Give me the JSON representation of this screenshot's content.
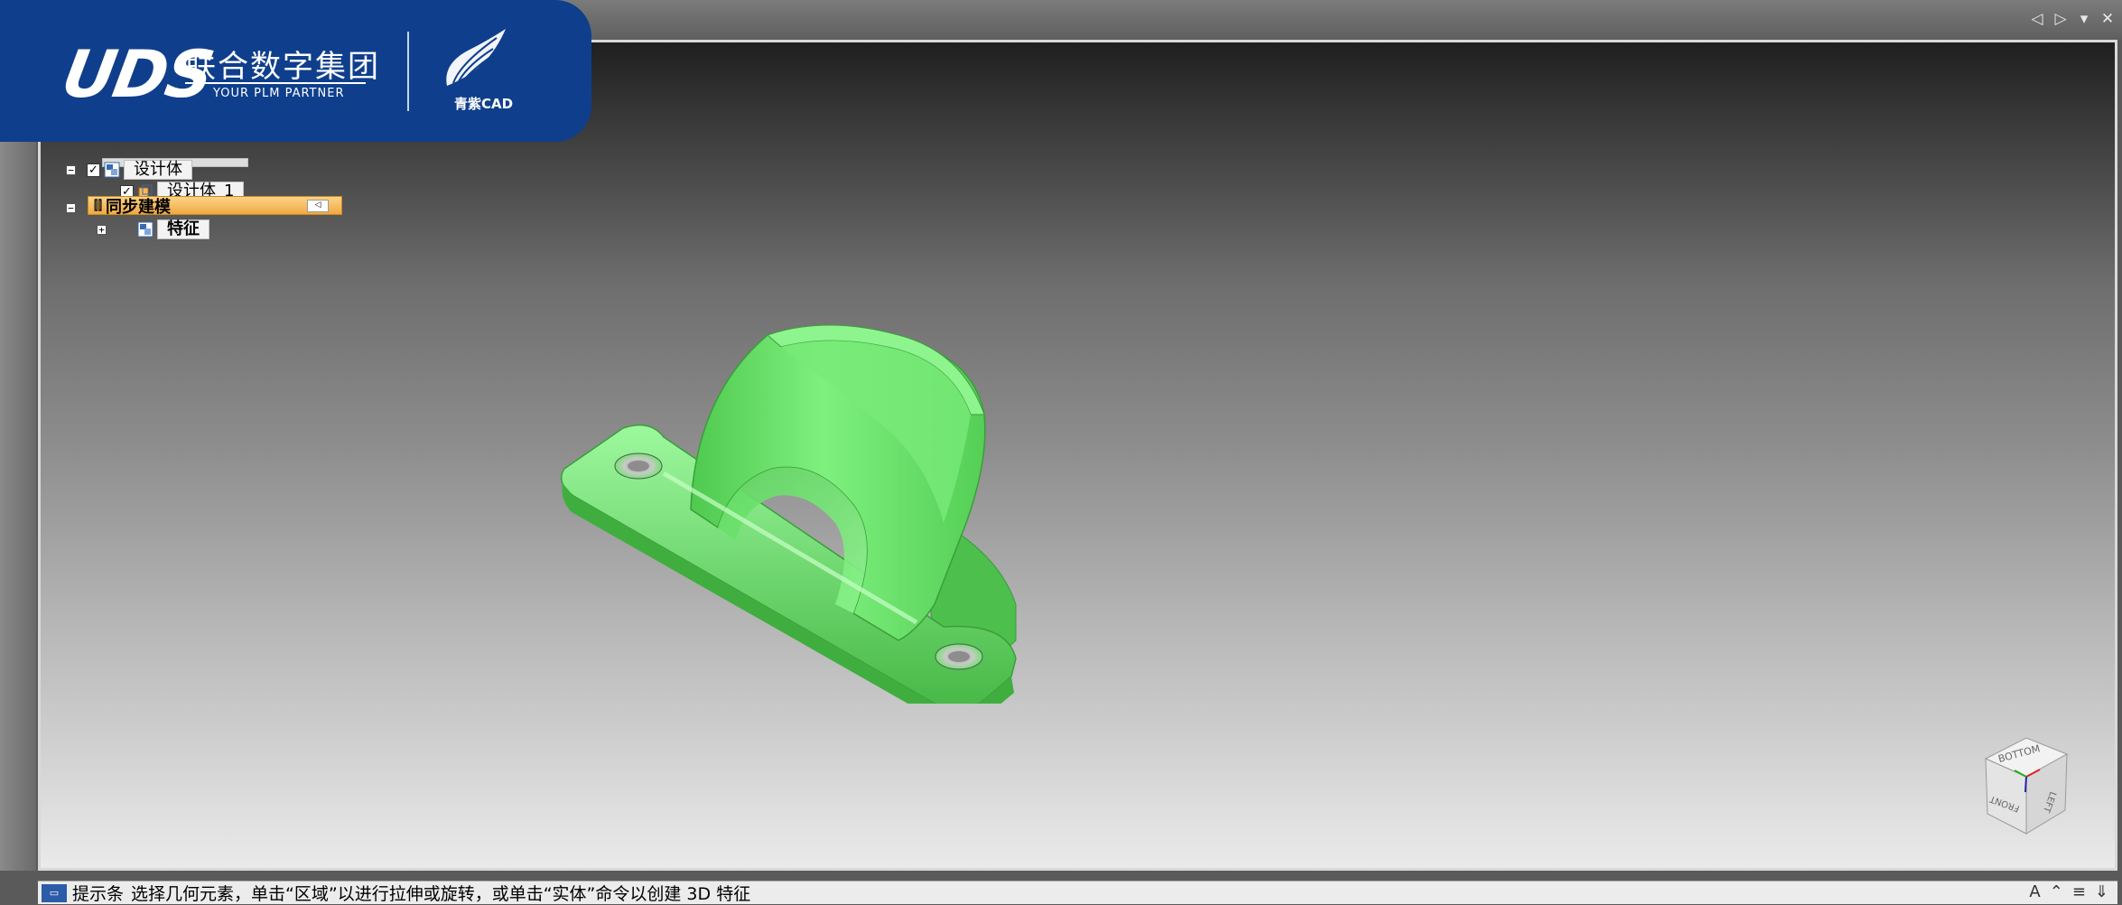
{
  "brand": {
    "logo_mark": "UDS",
    "name_cn": "联合数字集团",
    "tagline": "YOUR PLM PARTNER",
    "product": "青紫CAD",
    "color": "#0f3f8c"
  },
  "window_controls": {
    "prev": "◁",
    "next": "▷",
    "menu": "▾",
    "close": "✕"
  },
  "tree": {
    "design_body": "设计体",
    "design_body_1": "设计体_1",
    "sync_modeling": "同步建模",
    "features": "特征",
    "collapse_glyph": "−",
    "expand_glyph": "+",
    "check_glyph": "✓"
  },
  "model": {
    "color": "#6fe56f",
    "shade": "#4fc24f"
  },
  "navcube": {
    "top_face": "BOTTOM",
    "left_face": "FRONT",
    "right_face": "LEFT"
  },
  "status": {
    "label": "提示条",
    "message": "选择几何元素，单击“区域”以进行拉伸或旋转，或单击“实体”命令以创建 3D 特征",
    "right_icons": [
      "A",
      "⌃",
      "≡",
      "⇓"
    ]
  }
}
